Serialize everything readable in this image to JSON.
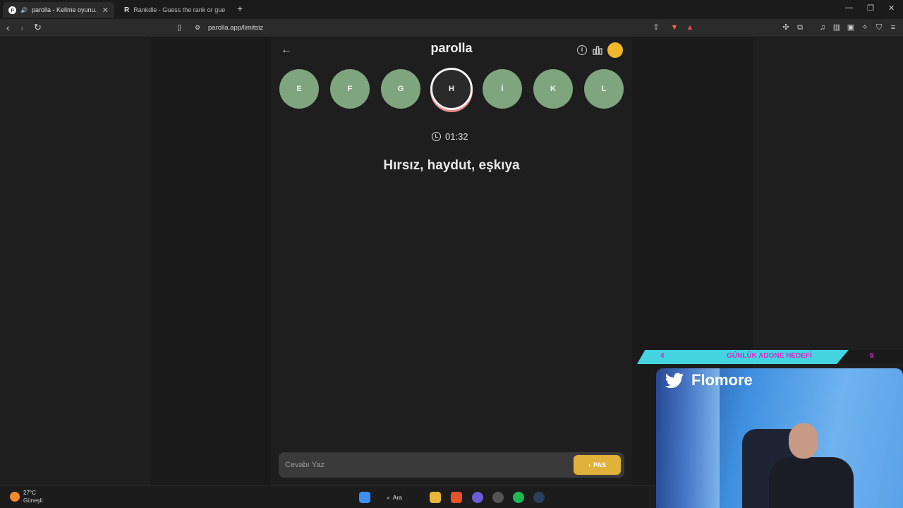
{
  "browser": {
    "tabs": [
      {
        "label": "parolla - Kelime oyunu. Günl",
        "active": true
      },
      {
        "label": "Rankdle - Guess the rank or guess th",
        "active": false
      }
    ],
    "url": "parolla.app/limitsiz"
  },
  "app": {
    "title": "parolla",
    "letters": [
      {
        "label": "E",
        "state": "done"
      },
      {
        "label": "F",
        "state": "done"
      },
      {
        "label": "G",
        "state": "done"
      },
      {
        "label": "H",
        "state": "current"
      },
      {
        "label": "İ",
        "state": "done"
      },
      {
        "label": "K",
        "state": "done"
      },
      {
        "label": "L",
        "state": "done"
      }
    ],
    "timer": "01:32",
    "question": "Hırsız, haydut, eşkıya",
    "answer": {
      "placeholder": "Cevabı Yaz",
      "value": ""
    },
    "pass_label": "PAS",
    "colors": {
      "letter_done": "#7fa57e",
      "pass_button": "#e0b23a"
    }
  },
  "overlay": {
    "banner_left": "4",
    "banner_title": "GÜNLÜK ADONE HEDEFİ",
    "banner_right": "5",
    "streamer_name": "Flomore"
  },
  "taskbar": {
    "weather_temp": "27°C",
    "weather_desc": "Güneşli",
    "search_label": "Ara"
  }
}
